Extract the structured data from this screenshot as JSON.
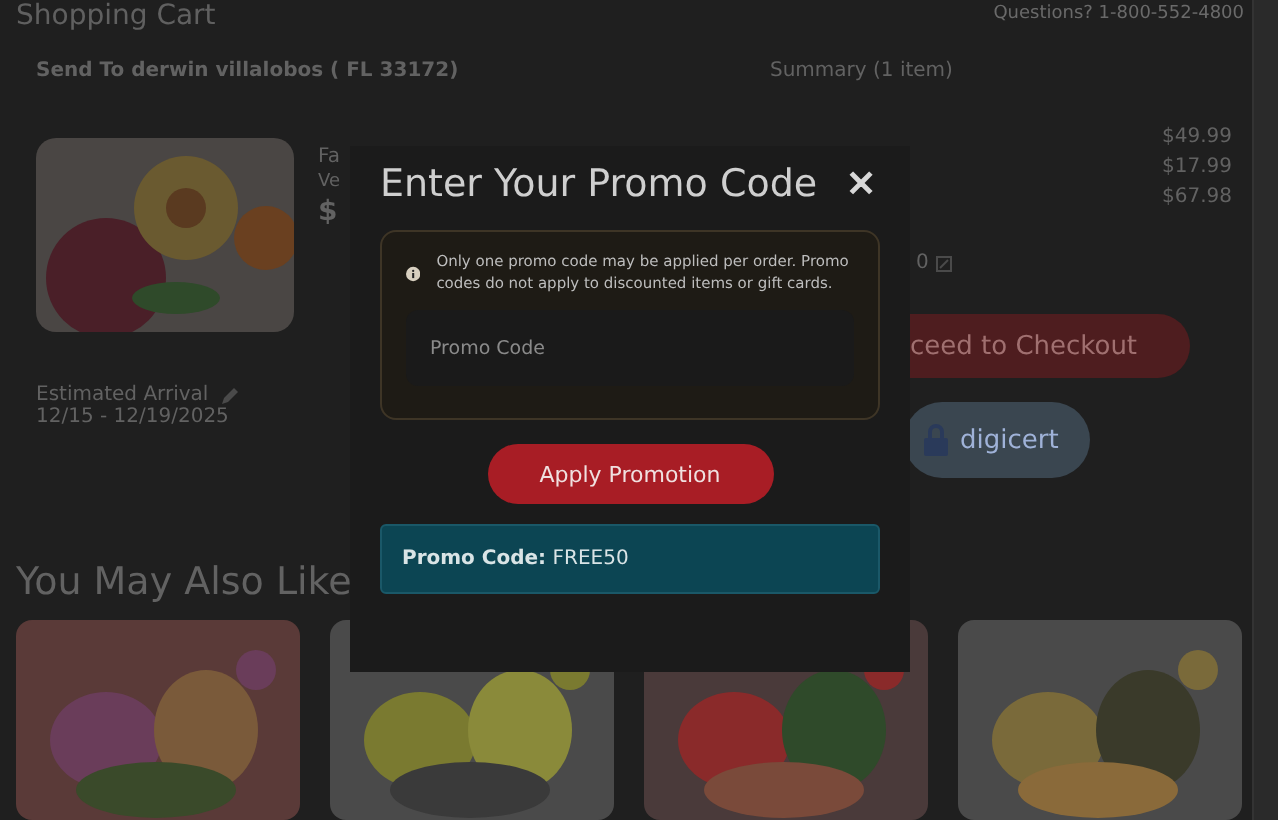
{
  "page": {
    "title": "Shopping Cart",
    "questions": "Questions? 1-800-552-4800"
  },
  "cart": {
    "send_to": "Send To derwin villalobos ( FL 33172)",
    "item": {
      "name_part": "Fa",
      "line_2": "Ve",
      "price_part": "$"
    },
    "arrival_label": "Estimated Arrival",
    "arrival_dates": "12/15 - 12/19/2025"
  },
  "summary": {
    "title": "Summary (1 item)",
    "amounts": [
      "$49.99",
      "$17.99",
      "$67.98"
    ],
    "code_part": "0",
    "checkout_button": "ceed to Checkout",
    "badge": "digicert"
  },
  "recommendations": {
    "title": "You May Also Like"
  },
  "modal": {
    "title": "Enter Your Promo Code",
    "close": "✕",
    "notice": "Only one promo code may be applied per order. Promo codes do not apply to discounted items or gift cards.",
    "input": {
      "placeholder": "Promo Code"
    },
    "apply_button": "Apply Promotion",
    "applied": "**Promo Code:** FREE50"
  }
}
